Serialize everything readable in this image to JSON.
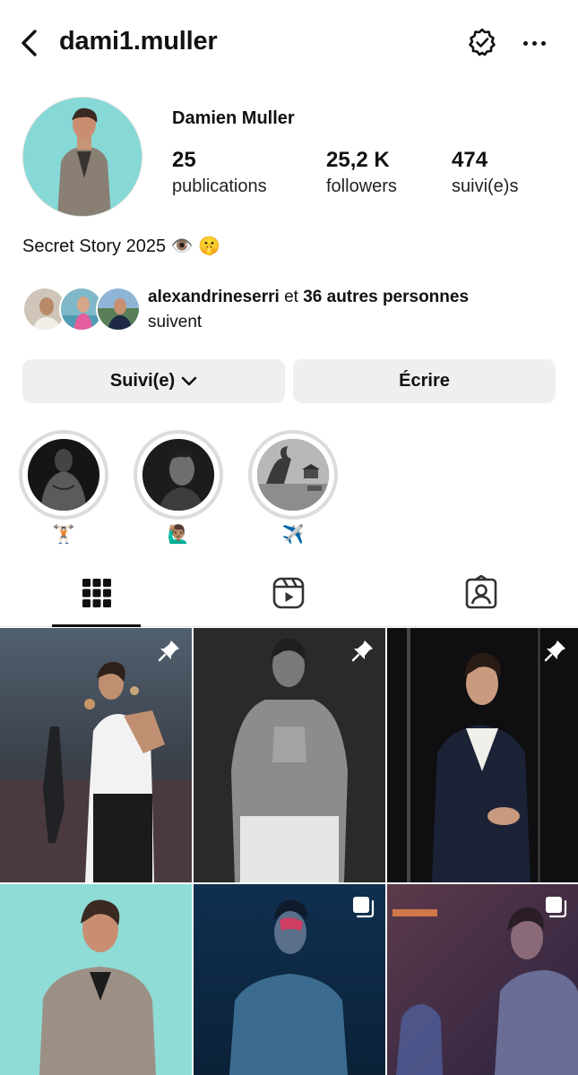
{
  "header": {
    "username": "dami1.muller",
    "back_icon": "chevron-left-icon",
    "bell_icon": "bell-check-icon",
    "more_icon": "more-horizontal-icon"
  },
  "profile": {
    "full_name": "Damien Muller",
    "stats": [
      {
        "value": "25",
        "label": "publications"
      },
      {
        "value": "25,2 K",
        "label": "followers"
      },
      {
        "value": "474",
        "label": "suivi(e)s"
      }
    ],
    "bio": "Secret Story 2025 👁️ 🤫",
    "followed_by": {
      "name": "alexandrineserri",
      "connector": " et ",
      "others": "36 autres personnes",
      "suffix": "suivent"
    }
  },
  "actions": {
    "follow_label": "Suivi(e)",
    "message_label": "Écrire"
  },
  "highlights": [
    {
      "label": "🏋🏻"
    },
    {
      "label": "🙋🏽‍♂️"
    },
    {
      "label": "✈️"
    }
  ],
  "tabs": [
    {
      "name": "grid",
      "icon": "grid-icon",
      "active": true
    },
    {
      "name": "reels",
      "icon": "reels-icon",
      "active": false
    },
    {
      "name": "tagged",
      "icon": "tagged-icon",
      "active": false
    }
  ],
  "posts": [
    {
      "badge": "pin-icon"
    },
    {
      "badge": "pin-icon"
    },
    {
      "badge": "pin-icon"
    },
    {
      "badge": ""
    },
    {
      "badge": "carousel-icon"
    },
    {
      "badge": "carousel-icon"
    }
  ],
  "colors": {
    "button_bg": "#efefef",
    "highlight_ring": "#dbdbe0",
    "text": "#111111"
  }
}
